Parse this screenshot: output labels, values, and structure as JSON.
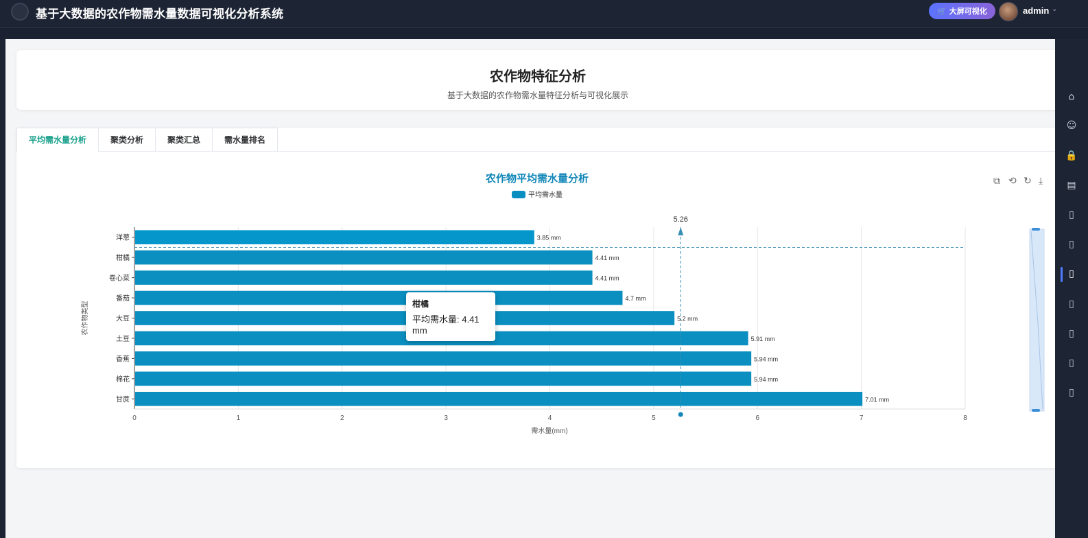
{
  "app": {
    "title": "基于大数据的农作物需水量数据可视化分析系统",
    "bigscreen_label": "大屏可视化",
    "user_name": "admin"
  },
  "page": {
    "title": "农作物特征分析",
    "subtitle": "基于大数据的农作物需水量特征分析与可视化展示"
  },
  "tabs": [
    {
      "label": "平均需水量分析",
      "active": true
    },
    {
      "label": "聚类分析",
      "active": false
    },
    {
      "label": "聚类汇总",
      "active": false
    },
    {
      "label": "需水量排名",
      "active": false
    }
  ],
  "tooltip": {
    "name": "柑橘",
    "text": "平均需水量: 4.41 mm"
  },
  "pointer": {
    "value_label": "5.26",
    "value": 5.26
  },
  "chart_data": {
    "type": "bar",
    "orientation": "horizontal",
    "title": "农作物平均需水量分析",
    "xlabel": "需水量(mm)",
    "ylabel": "农作物类型",
    "xlim": [
      0,
      8
    ],
    "x_ticks": [
      "0",
      "1",
      "2",
      "3",
      "4",
      "5",
      "6",
      "7",
      "8"
    ],
    "legend": "top-center",
    "categories": [
      "洋葱",
      "柑橘",
      "卷心菜",
      "番茄",
      "大豆",
      "土豆",
      "香蕉",
      "棉花",
      "甘蔗"
    ],
    "series": [
      {
        "name": "平均需水量",
        "values": [
          3.85,
          4.41,
          4.41,
          4.7,
          5.2,
          5.91,
          5.94,
          5.94,
          7.01
        ],
        "labels": [
          "3.85 mm",
          "4.41 mm",
          "4.41 mm",
          "4.7 mm",
          "5.2 mm",
          "5.91 mm",
          "5.94 mm",
          "5.94 mm",
          "7.01 mm"
        ],
        "color": "#0a8fc0"
      }
    ],
    "grid": true
  },
  "toolbox": [
    "zoom-icon",
    "zoom-reset-icon",
    "restore-icon",
    "download-icon"
  ],
  "sidebar_icons": [
    "home-icon",
    "user-icon",
    "lock-icon",
    "chart-board-icon",
    "document-icon",
    "document-icon",
    "document-icon",
    "document-icon",
    "document-icon",
    "document-icon",
    "document-icon"
  ]
}
